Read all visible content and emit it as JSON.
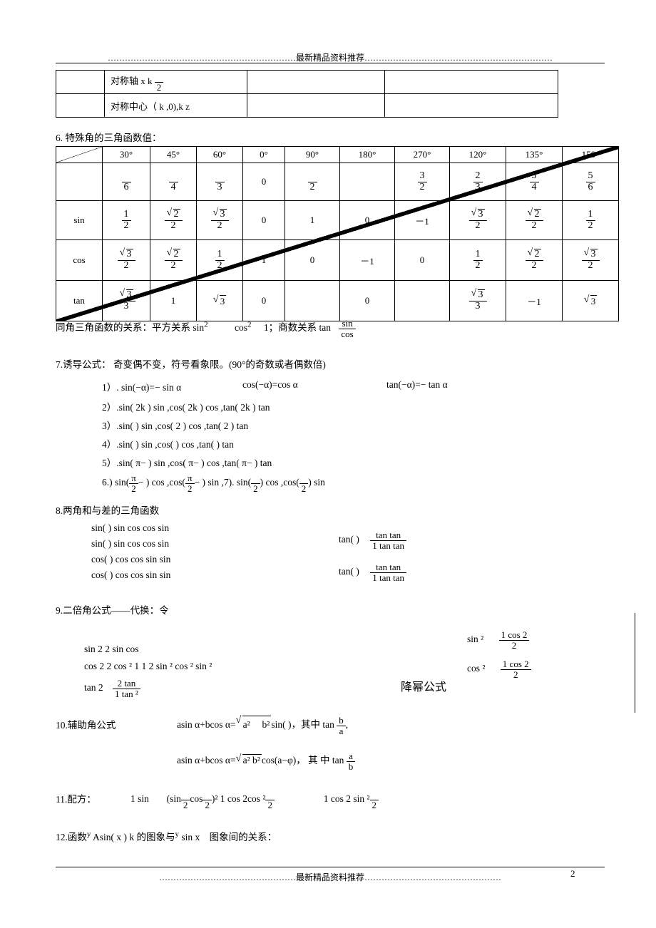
{
  "header": {
    "text": "…………………………………………………………最新精品资料推荐…………………………………………………………"
  },
  "footer": {
    "text": "…………………………………………最新精品资料推荐…………………………………………",
    "page": "2"
  },
  "top_table": {
    "rows": [
      {
        "cells": [
          "对称轴 x  k",
          "",
          ""
        ],
        "frac_n": "",
        "frac_d": "2"
      },
      {
        "cells": [
          "对称中心（  k  ,0),k  z",
          "",
          ""
        ]
      }
    ]
  },
  "sec6": {
    "title": "6. 特殊角的三角函数值：",
    "headers": [
      "",
      "30°",
      "45°",
      "60°",
      "0°",
      "90°",
      "180°",
      "270°",
      "120°",
      "135°",
      "150°"
    ],
    "rad_row": {
      "label": "",
      "cells": [
        {
          "type": "frac",
          "n": "",
          "d": "6"
        },
        {
          "type": "frac",
          "n": "",
          "d": "4"
        },
        {
          "type": "frac",
          "n": "",
          "d": "3"
        },
        {
          "type": "text",
          "v": "0"
        },
        {
          "type": "frac",
          "n": "",
          "d": "2"
        },
        {
          "type": "text",
          "v": ""
        },
        {
          "type": "frac",
          "n": "3",
          "d": "2"
        },
        {
          "type": "frac",
          "n": "2",
          "d": "3"
        },
        {
          "type": "frac",
          "n": "3",
          "d": "4"
        },
        {
          "type": "frac",
          "n": "5",
          "d": "6"
        }
      ]
    },
    "sin_row": {
      "label": "sin",
      "cells": [
        {
          "type": "frac",
          "n": "1",
          "d": "2"
        },
        {
          "type": "fracrad",
          "n": "2",
          "d": "2"
        },
        {
          "type": "fracrad",
          "n": "3",
          "d": "2"
        },
        {
          "type": "text",
          "v": "0"
        },
        {
          "type": "text",
          "v": "1"
        },
        {
          "type": "text",
          "v": "0"
        },
        {
          "type": "text",
          "v": "－1"
        },
        {
          "type": "fracrad",
          "n": "3",
          "d": "2"
        },
        {
          "type": "fracrad",
          "n": "2",
          "d": "2"
        },
        {
          "type": "frac",
          "n": "1",
          "d": "2"
        }
      ]
    },
    "cos_row": {
      "label": "cos",
      "cells": [
        {
          "type": "fracrad",
          "n": "3",
          "d": "2"
        },
        {
          "type": "fracrad",
          "n": "2",
          "d": "2"
        },
        {
          "type": "frac",
          "n": "1",
          "d": "2"
        },
        {
          "type": "text",
          "v": "1"
        },
        {
          "type": "text",
          "v": "0"
        },
        {
          "type": "text",
          "v": "－1"
        },
        {
          "type": "text",
          "v": "0"
        },
        {
          "type": "frac",
          "n": "1",
          "d": "2"
        },
        {
          "type": "fracrad",
          "n": "2",
          "d": "2"
        },
        {
          "type": "fracrad",
          "n": "3",
          "d": "2"
        }
      ]
    },
    "tan_row": {
      "label": "tan",
      "cells": [
        {
          "type": "fracrad",
          "n": "3",
          "d": "3"
        },
        {
          "type": "text",
          "v": "1"
        },
        {
          "type": "rad",
          "v": "3"
        },
        {
          "type": "text",
          "v": "0"
        },
        {
          "type": "diag",
          "v": ""
        },
        {
          "type": "text",
          "v": "0"
        },
        {
          "type": "diag",
          "v": ""
        },
        {
          "type": "fracrad",
          "n": "3",
          "d": "3"
        },
        {
          "type": "text",
          "v": "－1"
        },
        {
          "type": "rad",
          "v": "3"
        }
      ]
    },
    "relation": {
      "pre": "同角三角函数的关系：平方关系 sin",
      "sup1": "2",
      "mid": "cos",
      "sup2": "2",
      "post": "1；商数关系 tan",
      "frac_n": "sin",
      "frac_d": "cos"
    }
  },
  "sec7": {
    "title": "7.诱导公式：   奇变偶不变，符号看象限。(90°的奇数或者偶数倍)",
    "lines": [
      {
        "a": "1）. sin(−α)=− sin α",
        "b": "cos(−α)=cos α",
        "c": "tan(−α)=− tan α"
      },
      {
        "text": "2）.sin( 2k         )   sin    ,cos( 2k         )   cos  ,tan( 2k         )   tan"
      },
      {
        "text": "3）.sin(             )   sin   ,cos( 2          )   cos   ,tan( 2          )   tan"
      },
      {
        "text": "4）.sin(             )   sin   ,cos(             )   cos   ,tan(            )   tan"
      },
      {
        "text": "5）.sin( π−     )   sin  ,cos( π−   )     cos  ,tan( π−   )      tan"
      }
    ],
    "line6": {
      "p1": "6.) sin(",
      "f1n": "π",
      "f1d": "2",
      "p2": "−     )    cos   ,cos(",
      "f2n": "π",
      "f2d": "2",
      "p3": "−     )     sin  ,7). sin(",
      "f3n": "",
      "f3d": "2",
      "p4": ")     cos   ,cos(",
      "f4n": "",
      "f4d": "2",
      "p5": ")       sin"
    }
  },
  "sec8": {
    "title": "8.两角和与差的三角函数",
    "left": [
      "sin(          )   sin    cos     cos     sin",
      "sin(          )   sin    cos     cos     sin",
      "cos(          )   cos     cos      sin     sin",
      "cos(          )   cos     cos      sin     sin"
    ],
    "right": [
      {
        "pre": "tan(            )",
        "n": "tan        tan",
        "d": "1   tan      tan"
      },
      {
        "pre": "tan(            )",
        "n": "tan        tan",
        "d": "1   tan      tan"
      }
    ]
  },
  "sec9": {
    "title": "9.二倍角公式——代换：令",
    "lines": [
      "sin 2        2 sin      cos",
      "cos 2        2 cos ²    1   1   2 sin ²   cos ²     sin ²"
    ],
    "tan_line": {
      "pre": "tan 2",
      "n": "2 tan",
      "d": "1   tan ²"
    },
    "right": [
      {
        "pre": "sin ²",
        "n": "1    cos 2",
        "d": "2"
      },
      {
        "pre": "cos ²",
        "n": "1    cos 2",
        "d": "2"
      }
    ],
    "note": "降幂公式"
  },
  "sec10": {
    "title": "10.辅助角公式",
    "line1": {
      "pre": "asin α+bcos α=",
      "rad": "a² 　b²",
      "mid": "sin(          )，其中 tan",
      "fn": "b",
      "fd": "a",
      "end": ","
    },
    "line2": {
      "pre": "asin α+bcos α=",
      "rad": "a²    b²",
      "mid": "cos(a−φ)，  其  中 tan",
      "fn": "a",
      "fd": "b"
    }
  },
  "sec11": {
    "title": "11.配方：",
    "parts": {
      "p1": "1   sin",
      "p2": "(sin",
      "f1n": "",
      "f1d": "2",
      "p3": "cos",
      "f2n": "",
      "f2d": "2",
      "p4": ")²      1   cos        2cos ²",
      "f3n": "",
      "f3d": "2",
      "p5": "1   cos       2 sin ²",
      "f4n": "",
      "f4d": "2"
    }
  },
  "sec12": {
    "pre": "12.函数",
    "y1": "y",
    "f1": "Asin(   x      )   k",
    "mid": "的图象与",
    "y2": "y",
    "f2": "sin x",
    "post": "图象间的关系："
  }
}
